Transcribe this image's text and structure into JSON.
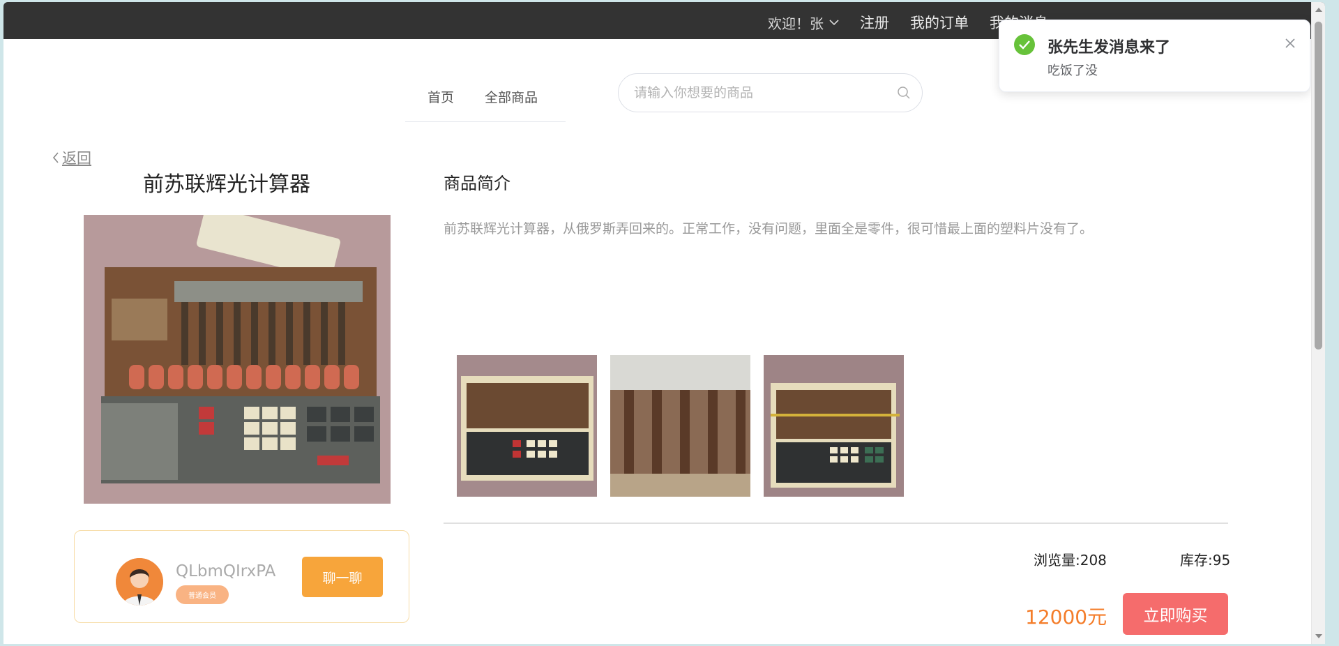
{
  "topbar": {
    "welcome": "欢迎！张",
    "register": "注册",
    "my_orders": "我的订单",
    "my_messages": "我的消息"
  },
  "menu": {
    "home": "首页",
    "all_products": "全部商品"
  },
  "search": {
    "placeholder": "请输入你想要的商品"
  },
  "back_label": "返回",
  "product": {
    "title": "前苏联辉光计算器",
    "section_title": "商品简介",
    "description": "前苏联辉光计算器，从俄罗斯弄回来的。正常工作，没有问题，里面全是零件，很可惜最上面的塑料片没有了。",
    "views": "浏览量:208",
    "stock": "库存:95",
    "price": "12000元",
    "buy_label": "立即购买"
  },
  "seller": {
    "name": "QLbmQIrxPA",
    "badge": "普通会员",
    "chat_label": "聊一聊"
  },
  "notification": {
    "title": "张先生发消息来了",
    "message": "吃饭了没"
  },
  "colors": {
    "topbar": "#333333",
    "price": "#f47d2a",
    "buy_button": "#f56c6c",
    "chat_button": "#f7a53b",
    "success": "#67c23a"
  },
  "icons": [
    "chevron-down-icon",
    "search-icon",
    "chevron-left-icon",
    "check-icon",
    "close-icon"
  ]
}
